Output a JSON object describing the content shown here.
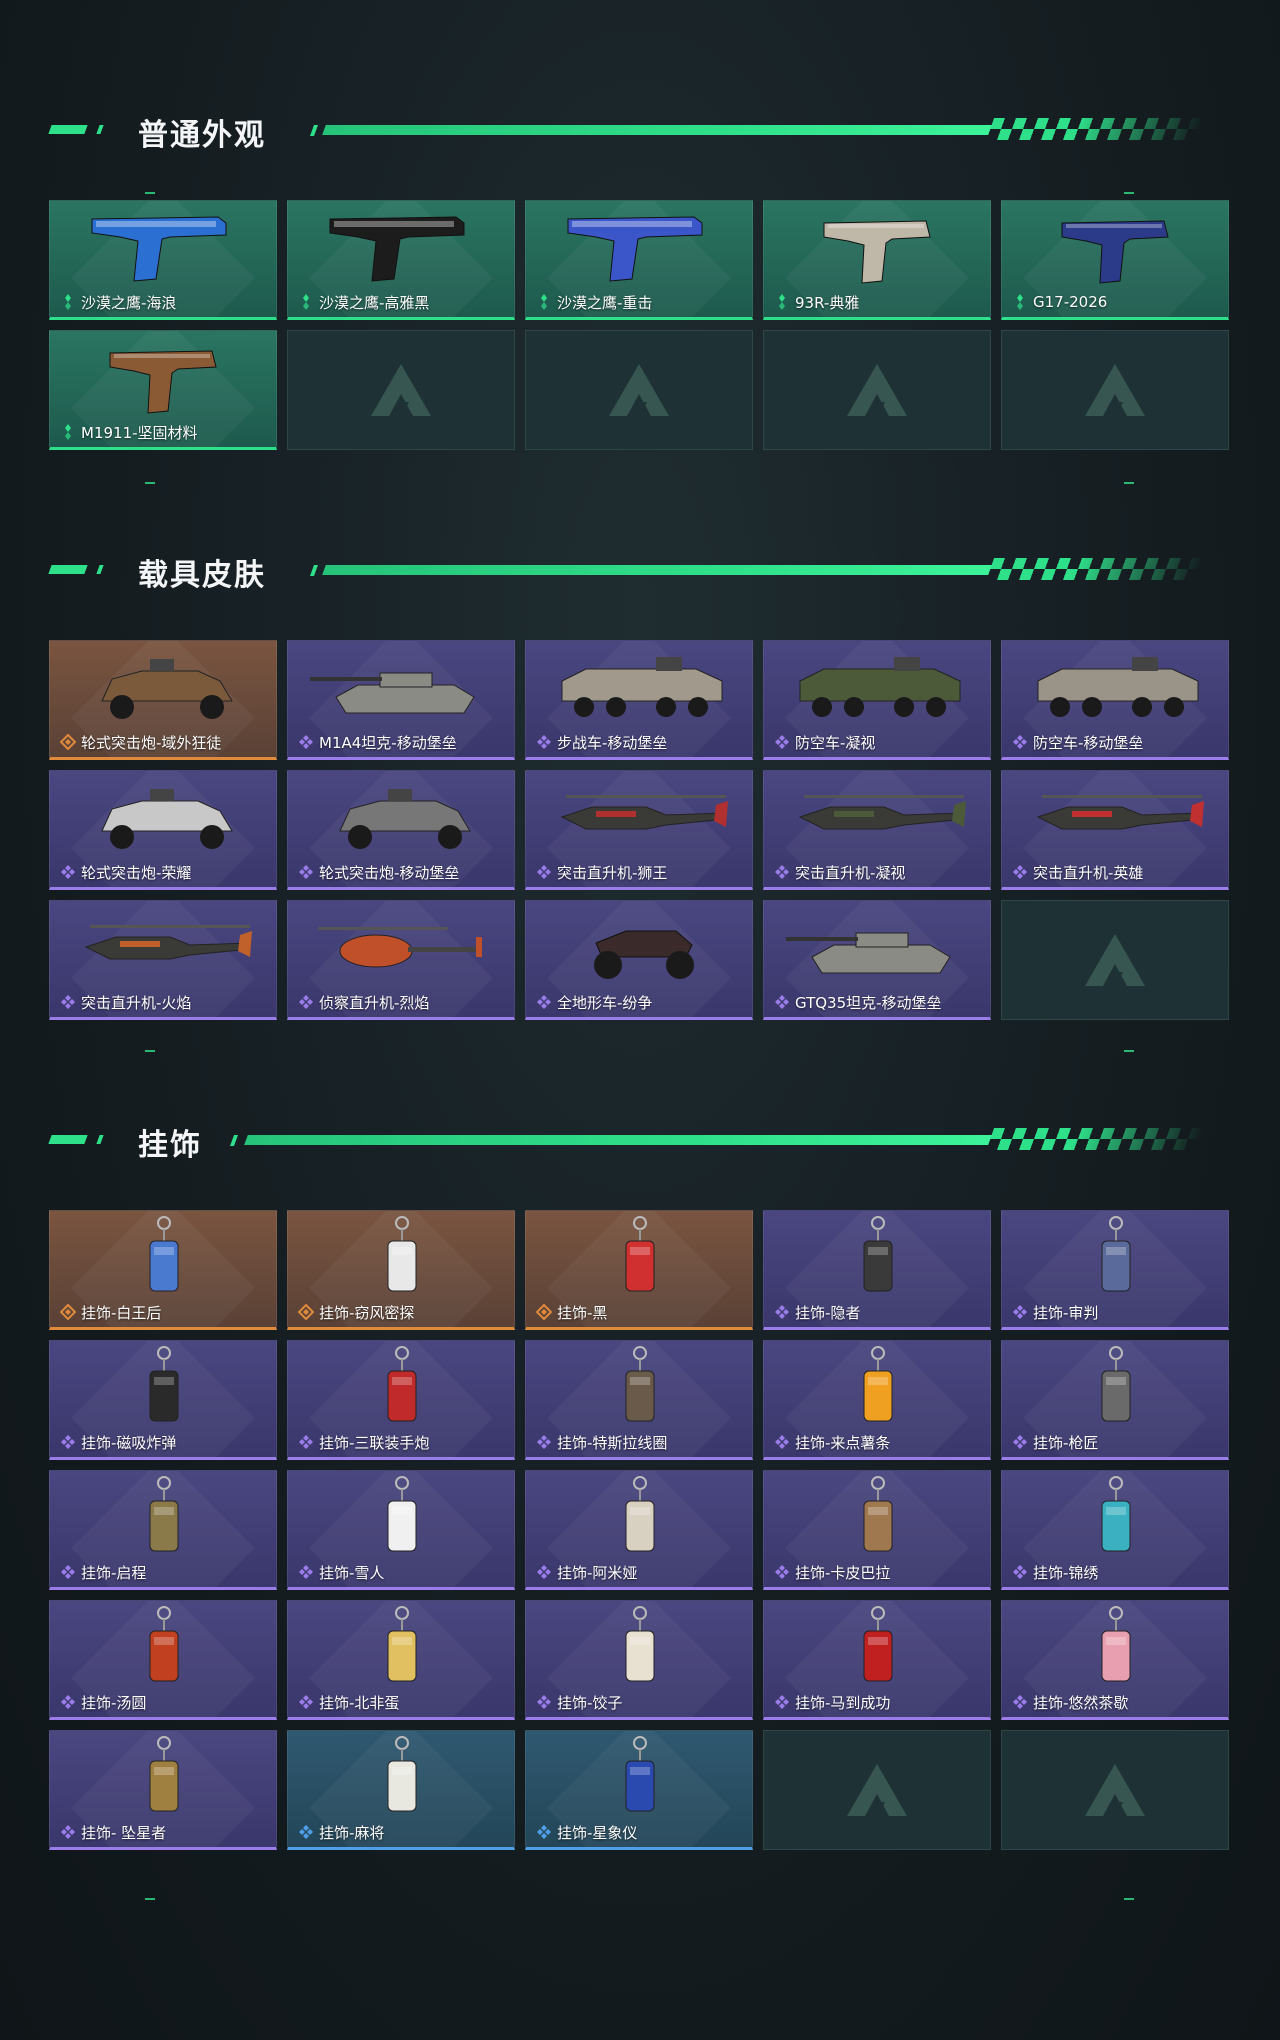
{
  "sections": [
    {
      "title": "普通外观",
      "items": [
        {
          "name": "沙漠之鹰-海浪",
          "rarity": "green",
          "art": "pistol",
          "accent": "#2a6fd1"
        },
        {
          "name": "沙漠之鹰-高雅黑",
          "rarity": "green",
          "art": "pistol",
          "accent": "#1c1c1c"
        },
        {
          "name": "沙漠之鹰-重击",
          "rarity": "green",
          "art": "pistol",
          "accent": "#3a56c8"
        },
        {
          "name": "93R-典雅",
          "rarity": "green",
          "art": "pistol2",
          "accent": "#bfb7a8"
        },
        {
          "name": "G17-2026",
          "rarity": "green",
          "art": "pistol2",
          "accent": "#2b3b8a"
        },
        {
          "name": "M1911-坚固材料",
          "rarity": "green",
          "art": "pistol2",
          "accent": "#8a5a34"
        }
      ],
      "empty_slots": 4
    },
    {
      "title": "载具皮肤",
      "items": [
        {
          "name": "轮式突击炮-域外狂徒",
          "rarity": "orange",
          "art": "car",
          "accent": "#7a5a3a"
        },
        {
          "name": "M1A4坦克-移动堡垒",
          "rarity": "purple",
          "art": "tank",
          "accent": "#8b8b86"
        },
        {
          "name": "步战车-移动堡垒",
          "rarity": "purple",
          "art": "apc",
          "accent": "#a0998c"
        },
        {
          "name": "防空车-凝视",
          "rarity": "purple",
          "art": "apc",
          "accent": "#4d5a3a"
        },
        {
          "name": "防空车-移动堡垒",
          "rarity": "purple",
          "art": "apc",
          "accent": "#9a9388"
        },
        {
          "name": "轮式突击炮-荣耀",
          "rarity": "purple",
          "art": "car",
          "accent": "#c8c8c8"
        },
        {
          "name": "轮式突击炮-移动堡垒",
          "rarity": "purple",
          "art": "car",
          "accent": "#777"
        },
        {
          "name": "突击直升机-狮王",
          "rarity": "purple",
          "art": "heli",
          "accent": "#b03030"
        },
        {
          "name": "突击直升机-凝视",
          "rarity": "purple",
          "art": "heli",
          "accent": "#4d5a3a"
        },
        {
          "name": "突击直升机-英雄",
          "rarity": "purple",
          "art": "heli",
          "accent": "#c03030"
        },
        {
          "name": "突击直升机-火焰",
          "rarity": "purple",
          "art": "heli",
          "accent": "#c0602a"
        },
        {
          "name": "侦察直升机-烈焰",
          "rarity": "purple",
          "art": "heli2",
          "accent": "#c0502a"
        },
        {
          "name": "全地形车-纷争",
          "rarity": "purple",
          "art": "atv",
          "accent": "#3a2a2a"
        },
        {
          "name": "GTQ35坦克-移动堡垒",
          "rarity": "purple",
          "art": "tank",
          "accent": "#8b8b86"
        }
      ],
      "empty_slots": 1
    },
    {
      "title": "挂饰",
      "items": [
        {
          "name": "挂饰-白王后",
          "rarity": "orange",
          "art": "charm",
          "accent": "#4a7ad0"
        },
        {
          "name": "挂饰-窃风密探",
          "rarity": "orange",
          "art": "charm",
          "accent": "#e8e8e8"
        },
        {
          "name": "挂饰-黑",
          "rarity": "orange",
          "art": "charm",
          "accent": "#d03030"
        },
        {
          "name": "挂饰-隐者",
          "rarity": "purple",
          "art": "charm",
          "accent": "#3a3a3a"
        },
        {
          "name": "挂饰-审判",
          "rarity": "purple",
          "art": "charm",
          "accent": "#5a6a9a"
        },
        {
          "name": "挂饰-磁吸炸弹",
          "rarity": "purple",
          "art": "charm",
          "accent": "#2a2a2a"
        },
        {
          "name": "挂饰-三联装手炮",
          "rarity": "purple",
          "art": "charm",
          "accent": "#c02a2a"
        },
        {
          "name": "挂饰-特斯拉线圈",
          "rarity": "purple",
          "art": "charm",
          "accent": "#6a5a4a"
        },
        {
          "name": "挂饰-来点薯条",
          "rarity": "purple",
          "art": "charm",
          "accent": "#f0a020"
        },
        {
          "name": "挂饰-枪匠",
          "rarity": "purple",
          "art": "charm",
          "accent": "#6a6a6a"
        },
        {
          "name": "挂饰-启程",
          "rarity": "purple",
          "art": "charm",
          "accent": "#8a7a4a"
        },
        {
          "name": "挂饰-雪人",
          "rarity": "purple",
          "art": "charm",
          "accent": "#f0f0f0"
        },
        {
          "name": "挂饰-阿米娅",
          "rarity": "purple",
          "art": "charm",
          "accent": "#d8d0c0"
        },
        {
          "name": "挂饰-卡皮巴拉",
          "rarity": "purple",
          "art": "charm",
          "accent": "#a07850"
        },
        {
          "name": "挂饰-锦绣",
          "rarity": "purple",
          "art": "charm",
          "accent": "#3ab0c0"
        },
        {
          "name": "挂饰-汤圆",
          "rarity": "purple",
          "art": "charm",
          "accent": "#c04020"
        },
        {
          "name": "挂饰-北非蛋",
          "rarity": "purple",
          "art": "charm",
          "accent": "#e0c060"
        },
        {
          "name": "挂饰-饺子",
          "rarity": "purple",
          "art": "charm",
          "accent": "#e8e0d0"
        },
        {
          "name": "挂饰-马到成功",
          "rarity": "purple",
          "art": "charm",
          "accent": "#c02020"
        },
        {
          "name": "挂饰-悠然茶歇",
          "rarity": "purple",
          "art": "charm",
          "accent": "#e8a0b0"
        },
        {
          "name": "挂饰- 坠星者",
          "rarity": "purple",
          "art": "charm",
          "accent": "#a08040"
        },
        {
          "name": "挂饰-麻将",
          "rarity": "blue",
          "art": "charm",
          "accent": "#e8e8e0"
        },
        {
          "name": "挂饰-星象仪",
          "rarity": "blue",
          "art": "charm",
          "accent": "#2a4ab0"
        }
      ],
      "empty_slots": 2
    }
  ],
  "colors": {
    "green_accent": "#2fe08a",
    "rarity_green": "#2fe08a",
    "rarity_purple": "#9a7de8",
    "rarity_orange": "#e08a3c",
    "rarity_blue": "#4fa0e8"
  }
}
